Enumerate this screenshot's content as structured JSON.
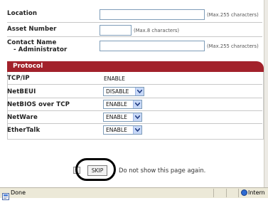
{
  "form": {
    "location": {
      "label": "Location",
      "value": "",
      "note": "(Max.255 characters)"
    },
    "asset": {
      "label": "Asset Number",
      "value": "",
      "note": "(Max.8 characters)"
    },
    "contact": {
      "label_line1": "Contact Name",
      "label_line2": "- Administrator",
      "value": "",
      "note": "(Max.255 characters)"
    }
  },
  "protocol": {
    "title": "Protocol",
    "rows": [
      {
        "label": "TCP/IP",
        "value": "ENABLE"
      },
      {
        "label": "NetBEUI",
        "value": "DISABLE"
      },
      {
        "label": "NetBIOS over TCP",
        "value": "ENABLE"
      },
      {
        "label": "NetWare",
        "value": "ENABLE"
      },
      {
        "label": "EtherTalk",
        "value": "ENABLE"
      }
    ]
  },
  "skip": {
    "button": "SKIP",
    "text": "Do not show this page again."
  },
  "statusbar": {
    "status": "Done",
    "zone": "Intern"
  },
  "colors": {
    "protocol_header": "#a2222b",
    "annotation_ring": "#000000"
  }
}
